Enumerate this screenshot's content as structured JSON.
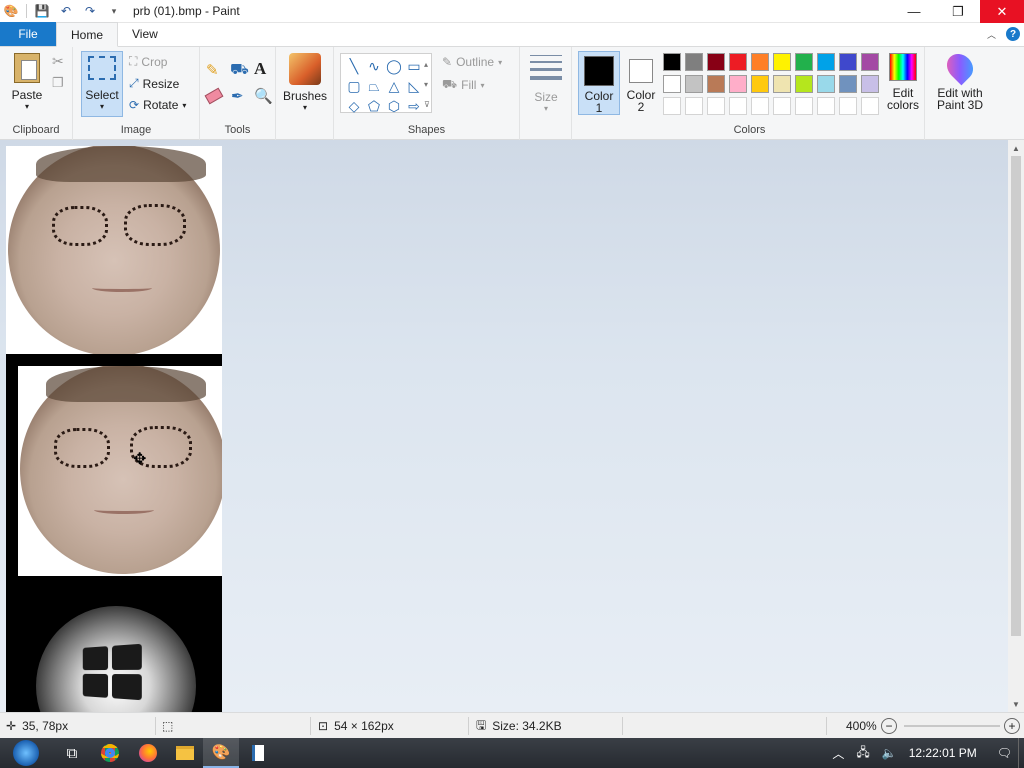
{
  "titlebar": {
    "title": "prb (01).bmp - Paint",
    "minimize": "—",
    "maximize": "❐",
    "close": "✕"
  },
  "tabs": {
    "file": "File",
    "home": "Home",
    "view": "View"
  },
  "ribbon": {
    "clipboard": {
      "label": "Clipboard",
      "paste": "Paste"
    },
    "image": {
      "label": "Image",
      "select": "Select",
      "crop": "Crop",
      "resize": "Resize",
      "rotate": "Rotate"
    },
    "tools": {
      "label": "Tools"
    },
    "brushes": {
      "label": "Brushes"
    },
    "shapes": {
      "label": "Shapes",
      "outline": "Outline",
      "fill": "Fill"
    },
    "size": {
      "label": "Size"
    },
    "color1": {
      "label": "Color",
      "num": "1",
      "value": "#000000"
    },
    "color2": {
      "label": "Color",
      "num": "2",
      "value": "#ffffff"
    },
    "colors": {
      "label": "Colors"
    },
    "edit_colors": {
      "line1": "Edit",
      "line2": "colors"
    },
    "paint3d": {
      "line1": "Edit with",
      "line2": "Paint 3D"
    },
    "palette_row1": [
      "#000000",
      "#7f7f7f",
      "#880015",
      "#ed1c24",
      "#ff7f27",
      "#fff200",
      "#22b14c",
      "#00a2e8",
      "#3f48cc",
      "#a349a4"
    ],
    "palette_row2": [
      "#ffffff",
      "#c3c3c3",
      "#b97a57",
      "#ffaec9",
      "#ffc90e",
      "#efe4b0",
      "#b5e61d",
      "#99d9ea",
      "#7092be",
      "#c8bfe7"
    ],
    "palette_row3": [
      "#ffffff",
      "#ffffff",
      "#ffffff",
      "#ffffff",
      "#ffffff",
      "#ffffff",
      "#ffffff",
      "#ffffff",
      "#ffffff",
      "#ffffff"
    ]
  },
  "status": {
    "cursor_pos": "35, 78px",
    "dimensions": "54 × 162px",
    "size": "Size: 34.2KB",
    "zoom": "400%"
  },
  "taskbar": {
    "time": "12:22:01 PM"
  }
}
